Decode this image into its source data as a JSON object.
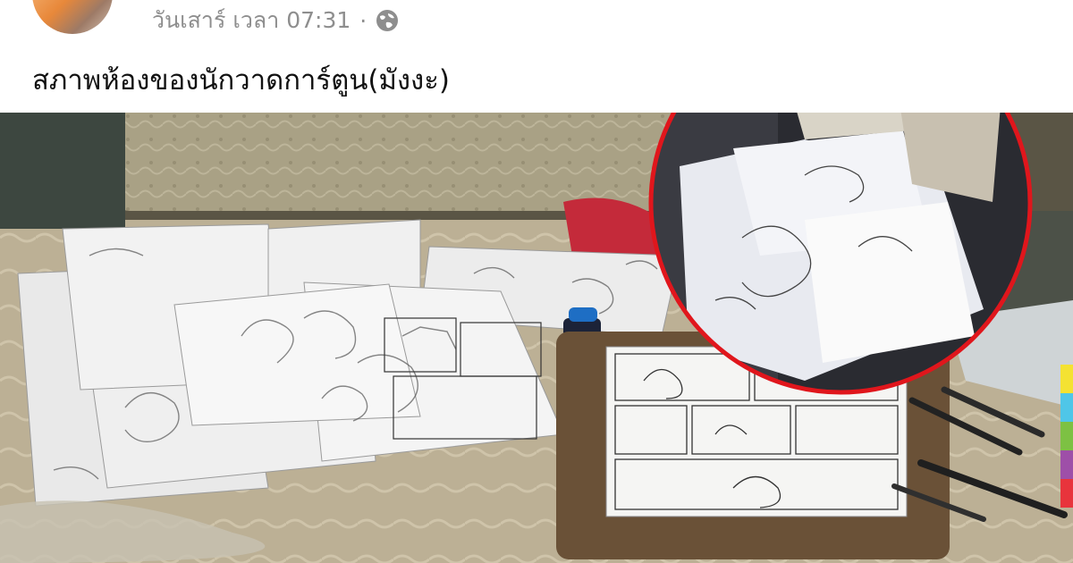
{
  "post": {
    "timestamp": "วันเสาร์ เวลา 07:31",
    "separator": "·",
    "title": "สภาพห้องของนักวาดการ์ตูน(มังงะ)"
  },
  "icons": {
    "privacy": "globe-icon"
  },
  "colors": {
    "meta_text": "#8e8e8e",
    "title_text": "#111111",
    "highlight_circle": "#e0161c"
  },
  "sidebar_colors": [
    "#f4e232",
    "#4fc6e8",
    "#7dc143",
    "#9e4fa8",
    "#e8343c"
  ]
}
